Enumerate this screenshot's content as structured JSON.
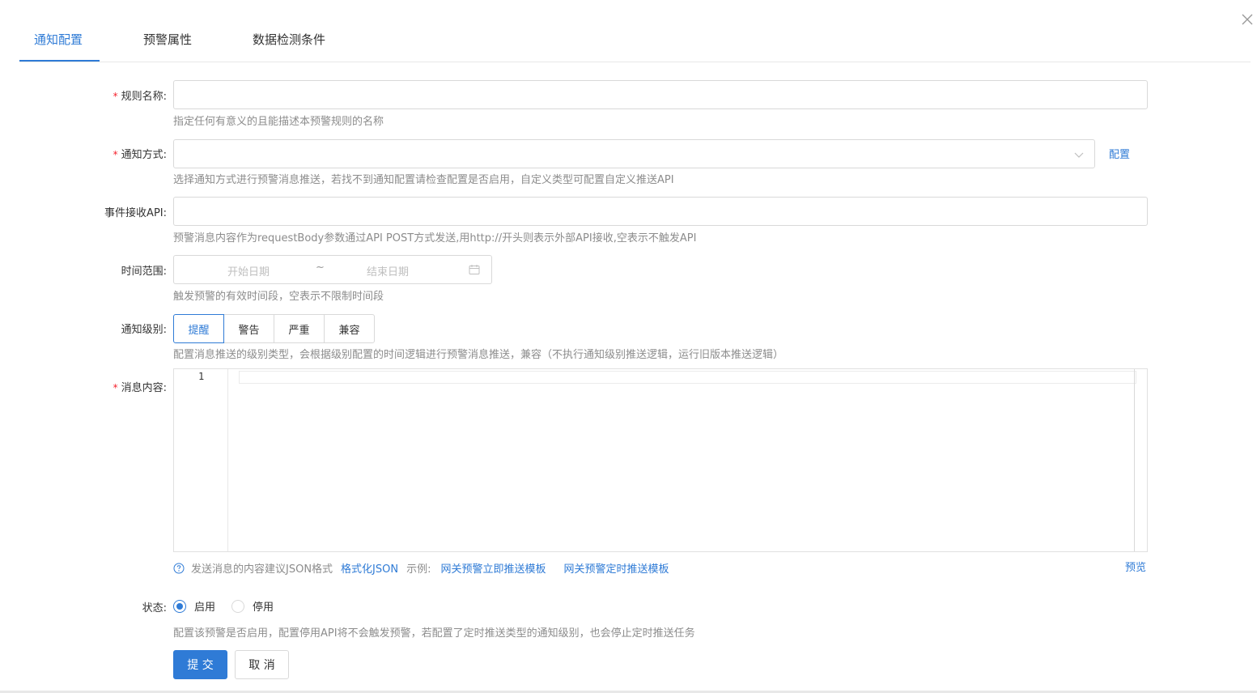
{
  "tabs": [
    {
      "label": "通知配置",
      "active": true
    },
    {
      "label": "预警属性",
      "active": false
    },
    {
      "label": "数据检测条件",
      "active": false
    }
  ],
  "form": {
    "rule_name": {
      "label": "规则名称:",
      "value": "",
      "help": "指定任何有意义的且能描述本预警规则的名称"
    },
    "notify_method": {
      "label": "通知方式:",
      "value": "",
      "config_link": "配置",
      "help": "选择通知方式进行预警消息推送，若找不到通知配置请检查配置是否启用，自定义类型可配置自定义推送API"
    },
    "event_api": {
      "label": "事件接收API:",
      "value": "",
      "help": "预警消息内容作为requestBody参数通过API POST方式发送,用http://开头则表示外部API接收,空表示不触发API"
    },
    "time_range": {
      "label": "时间范围:",
      "start_placeholder": "开始日期",
      "separator": "~",
      "end_placeholder": "结束日期",
      "help": "触发预警的有效时间段，空表示不限制时间段"
    },
    "notify_level": {
      "label": "通知级别:",
      "options": [
        "提醒",
        "警告",
        "严重",
        "兼容"
      ],
      "selected": "提醒",
      "help": "配置消息推送的级别类型，会根据级别配置的时间逻辑进行预警消息推送，兼容（不执行通知级别推送逻辑，运行旧版本推送逻辑）"
    },
    "message_content": {
      "label": "消息内容:",
      "line_number": "1",
      "hint_text": "发送消息的内容建议JSON格式",
      "format_link": "格式化JSON",
      "example_label": "示例:",
      "template_link_1": "网关预警立即推送模板",
      "template_link_2": "网关预警定时推送模板",
      "preview_link": "预览"
    },
    "status": {
      "label": "状态:",
      "options": [
        "启用",
        "停用"
      ],
      "selected": "启用",
      "help": "配置该预警是否启用，配置停用API将不会触发预警，若配置了定时推送类型的通知级别，也会停止定时推送任务"
    }
  },
  "actions": {
    "submit": "提 交",
    "cancel": "取 消"
  },
  "colors": {
    "primary": "#2f7bd6",
    "required": "#f5222d",
    "help_text": "#8c8c8c",
    "border": "#d9d9d9"
  }
}
